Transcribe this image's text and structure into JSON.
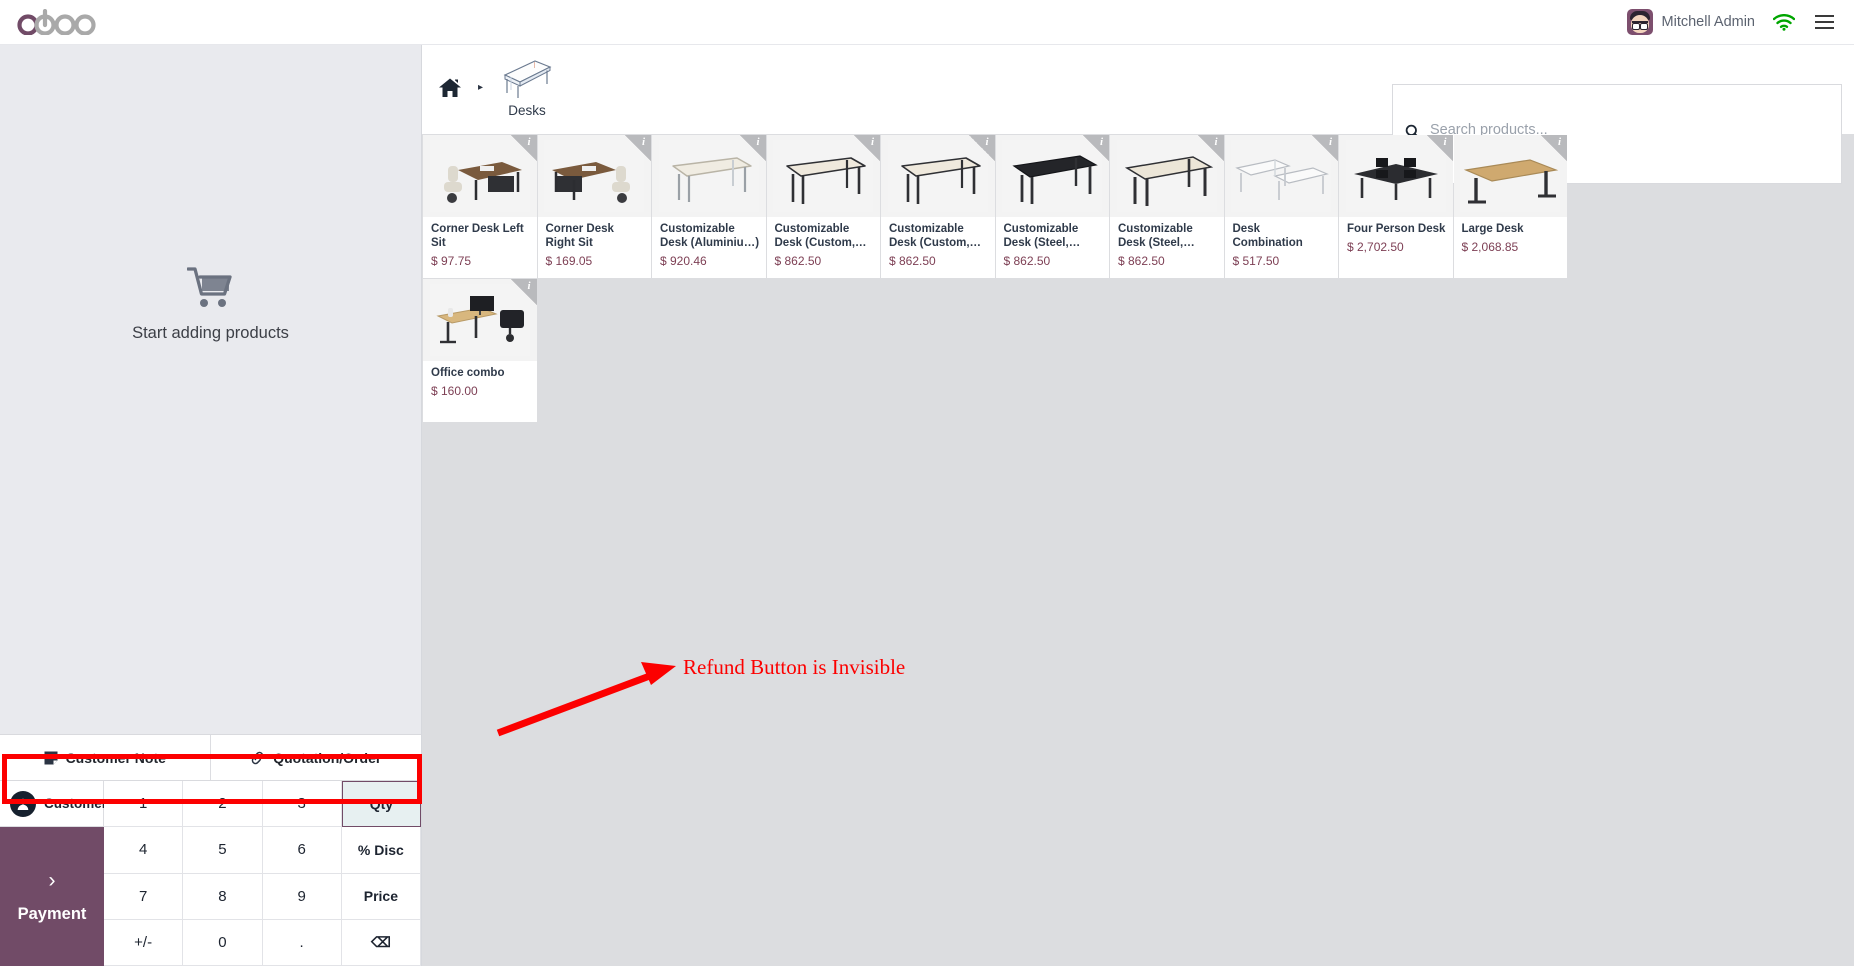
{
  "topbar": {
    "logo_text": "odoo",
    "user_name": "Mitchell Admin",
    "avatar_name": "user-avatar",
    "wifi_name": "wifi-icon",
    "menu_name": "hamburger-menu",
    "accent_purple": "#714b67",
    "wifi_color": "#00a500"
  },
  "order_panel": {
    "empty_text": "Start adding products",
    "actions": [
      {
        "label": "Customer Note",
        "icon": "note-icon"
      },
      {
        "label": "Quotation/Order",
        "icon": "link-icon"
      }
    ],
    "customer_label": "Customer",
    "payment_label": "Payment",
    "payment_chevron": "›",
    "numpad": [
      {
        "label": "1",
        "kind": "digit"
      },
      {
        "label": "2",
        "kind": "digit"
      },
      {
        "label": "3",
        "kind": "digit"
      },
      {
        "label": "Qty",
        "kind": "mode",
        "active": true
      },
      {
        "label": "4",
        "kind": "digit"
      },
      {
        "label": "5",
        "kind": "digit"
      },
      {
        "label": "6",
        "kind": "digit"
      },
      {
        "label": "% Disc",
        "kind": "mode",
        "active": false
      },
      {
        "label": "7",
        "kind": "digit"
      },
      {
        "label": "8",
        "kind": "digit"
      },
      {
        "label": "9",
        "kind": "digit"
      },
      {
        "label": "Price",
        "kind": "mode",
        "active": false
      },
      {
        "label": "+/-",
        "kind": "digit"
      },
      {
        "label": "0",
        "kind": "digit"
      },
      {
        "label": ".",
        "kind": "digit"
      },
      {
        "label": "⌫",
        "kind": "backspace",
        "active": false
      }
    ]
  },
  "products_panel": {
    "breadcrumb": {
      "home_icon": "home-icon",
      "separator": "▸",
      "category_label": "Desks",
      "category_icon": "desk-thumbnail"
    },
    "search": {
      "placeholder": "Search products...",
      "value": "",
      "icon": "search-icon"
    },
    "info_badge_char": "i",
    "products": [
      {
        "name": "Corner Desk Left Sit",
        "price": "$ 97.75",
        "img": "corner-desk-left"
      },
      {
        "name": "Corner Desk Right Sit",
        "price": "$ 169.05",
        "img": "corner-desk-right"
      },
      {
        "name": "Customizable Desk (Aluminiu…)",
        "price": "$ 920.46",
        "img": "desk-aluminium"
      },
      {
        "name": "Customizable Desk (Custom,…",
        "price": "$ 862.50",
        "img": "desk-custom-1"
      },
      {
        "name": "Customizable Desk (Custom,…",
        "price": "$ 862.50",
        "img": "desk-custom-2"
      },
      {
        "name": "Customizable Desk (Steel,…",
        "price": "$ 862.50",
        "img": "desk-steel-black"
      },
      {
        "name": "Customizable Desk (Steel,…",
        "price": "$ 862.50",
        "img": "desk-steel-white"
      },
      {
        "name": "Desk Combination",
        "price": "$ 517.50",
        "img": "desk-combination"
      },
      {
        "name": "Four Person Desk",
        "price": "$ 2,702.50",
        "img": "four-person-desk"
      },
      {
        "name": "Large Desk",
        "price": "$ 2,068.85",
        "img": "large-desk"
      },
      {
        "name": "Office combo",
        "price": "$ 160.00",
        "img": "office-combo"
      }
    ]
  },
  "annotation": {
    "text": "Refund Button is Invisible",
    "color": "#fc0000"
  }
}
